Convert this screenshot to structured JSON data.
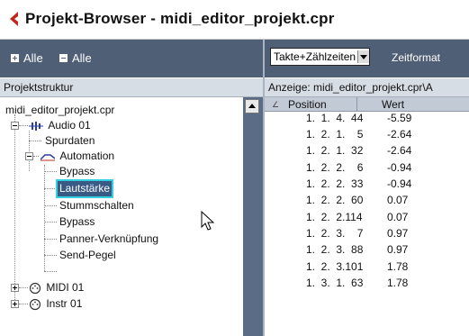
{
  "window": {
    "title": "Projekt-Browser - midi_editor_projekt.cpr",
    "logo_icon": "cubase-logo-icon",
    "accent": "#c0281e"
  },
  "left_panel": {
    "expand_all_label": "Alle",
    "collapse_all_label": "Alle",
    "header": "Projektstruktur",
    "tree": [
      {
        "label": "midi_editor_projekt.cpr"
      },
      {
        "label": "Audio 01",
        "icon": "audio-track-icon"
      },
      {
        "label": "Spurdaten"
      },
      {
        "label": "Automation",
        "icon": "automation-icon"
      },
      {
        "label": "Bypass"
      },
      {
        "label": "Lautstärke",
        "selected": true
      },
      {
        "label": "Stummschalten"
      },
      {
        "label": "Bypass"
      },
      {
        "label": "Panner-Verknüpfung"
      },
      {
        "label": "Send-Pegel"
      },
      {
        "label": "MIDI 01",
        "icon": "midi-track-icon"
      },
      {
        "label": "Instr 01",
        "icon": "instrument-track-icon"
      }
    ]
  },
  "right_panel": {
    "format_select": "Takte+Zählzeiten",
    "format_label": "Zeitformat",
    "display_path": "Anzeige: midi_editor_projekt.cpr\\A",
    "columns": {
      "position": "Position",
      "value": "Wert"
    },
    "rows": [
      {
        "position": "1.  1.  4.  44",
        "value": "-5.59"
      },
      {
        "position": "1.  2.  1.    5",
        "value": "-2.64"
      },
      {
        "position": "1.  2.  1.  32",
        "value": "-2.64"
      },
      {
        "position": "1.  2.  2.    6",
        "value": "-0.94"
      },
      {
        "position": "1.  2.  2.  33",
        "value": "-0.94"
      },
      {
        "position": "1.  2.  2.  60",
        "value": "0.07"
      },
      {
        "position": "1.  2.  2.114",
        "value": "0.07"
      },
      {
        "position": "1.  2.  3.    7",
        "value": "0.97"
      },
      {
        "position": "1.  2.  3.  88",
        "value": "0.97"
      },
      {
        "position": "1.  2.  3.101",
        "value": "1.78"
      },
      {
        "position": "1.  3.  1.  63",
        "value": "1.78"
      }
    ]
  }
}
